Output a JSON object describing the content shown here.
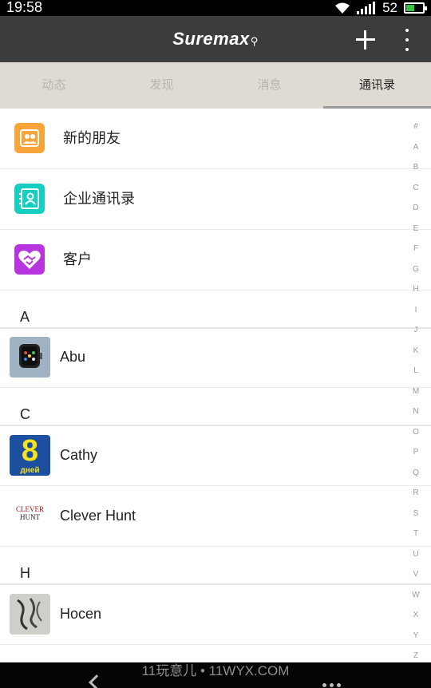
{
  "status_bar": {
    "time": "19:58",
    "battery": "52",
    "battery_level": 0.52
  },
  "app_bar": {
    "title": "Suremax",
    "title_suffix": "⚲"
  },
  "tabs": [
    {
      "label": "动态"
    },
    {
      "label": "发现"
    },
    {
      "label": "消息"
    },
    {
      "label": "通讯录"
    }
  ],
  "shortcuts": [
    {
      "label": "新的朋友",
      "icon": "new-friends-icon",
      "color": "#f7a43b"
    },
    {
      "label": "企业通讯录",
      "icon": "company-contacts-icon",
      "color": "#16cfc0"
    },
    {
      "label": "客户",
      "icon": "customer-icon",
      "color": "#b734de"
    }
  ],
  "sections": [
    {
      "letter": "A",
      "contacts": [
        {
          "name": "Abu"
        }
      ]
    },
    {
      "letter": "C",
      "contacts": [
        {
          "name": "Cathy",
          "avatar_text": "8",
          "avatar_sub": "дней"
        },
        {
          "name": "Clever Hunt",
          "avatar_text": "CLEVER",
          "avatar_sub": "HUNT"
        }
      ]
    },
    {
      "letter": "H",
      "contacts": [
        {
          "name": "Hocen"
        }
      ]
    }
  ],
  "index_letters": [
    "#",
    "A",
    "B",
    "C",
    "D",
    "E",
    "F",
    "G",
    "H",
    "I",
    "J",
    "K",
    "L",
    "M",
    "N",
    "O",
    "P",
    "Q",
    "R",
    "S",
    "T",
    "U",
    "V",
    "W",
    "X",
    "Y",
    "Z"
  ],
  "watermark": "11玩意儿 • 11WYX.COM"
}
